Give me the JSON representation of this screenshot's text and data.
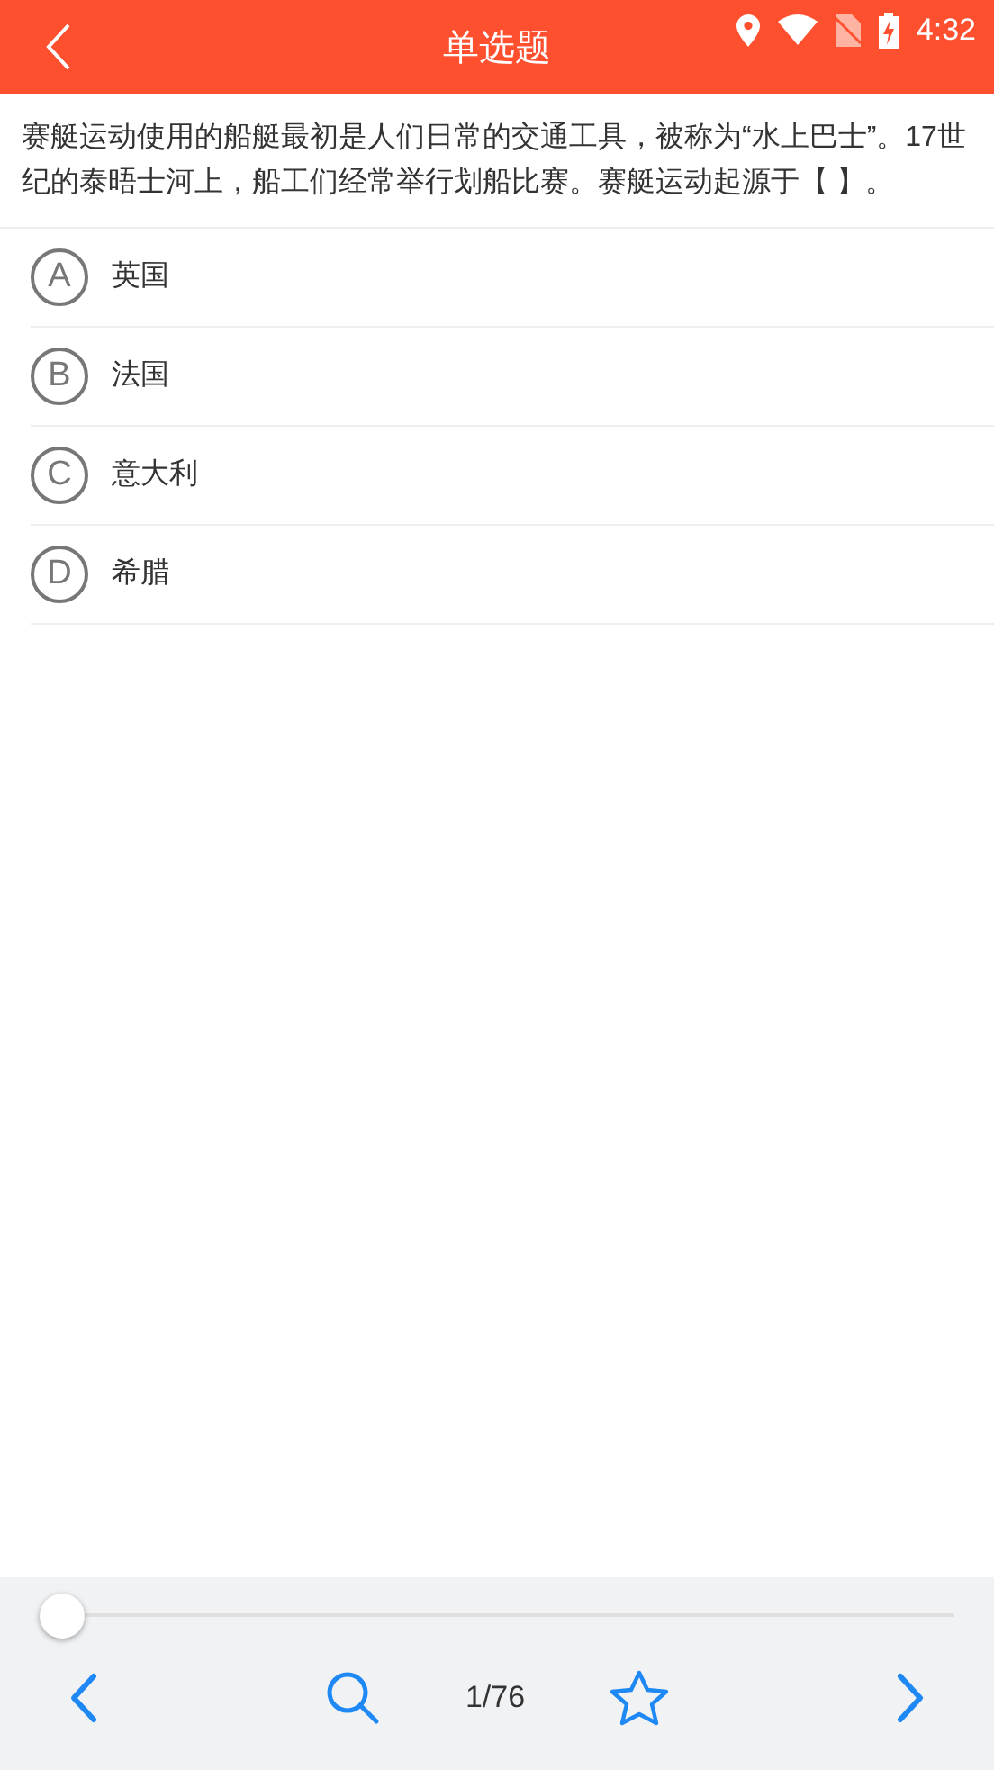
{
  "status_bar": {
    "time": "4:32"
  },
  "header": {
    "title": "单选题"
  },
  "question": "赛艇运动使用的船艇最初是人们日常的交通工具，被称为“水上巴士”。17世纪的泰晤士河上，船工们经常举行划船比赛。赛艇运动起源于【 】。",
  "options": [
    {
      "letter": "A",
      "text": "英国",
      "selected": false
    },
    {
      "letter": "B",
      "text": "法国",
      "selected": false
    },
    {
      "letter": "C",
      "text": "意大利",
      "selected": false
    },
    {
      "letter": "D",
      "text": "希腊",
      "selected": false
    }
  ],
  "progress_slider": {
    "level": 0
  },
  "bottom_bar": {
    "page": "1/76",
    "favorited": false
  }
}
